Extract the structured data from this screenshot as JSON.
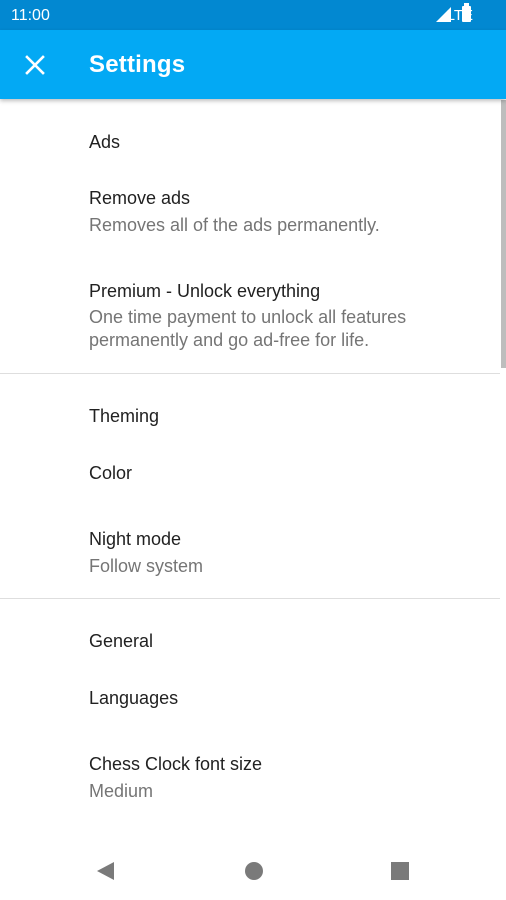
{
  "status_bar": {
    "time": "11:00",
    "network": "LTE",
    "signal_icon": "signal-icon",
    "battery_icon": "battery-icon"
  },
  "app_bar": {
    "title": "Settings",
    "close_icon": "close-icon",
    "color": "#03a9f4"
  },
  "sections": {
    "ads": {
      "header": "Ads",
      "remove_ads": {
        "title": "Remove ads",
        "summary": "Removes all of the ads permanently."
      },
      "premium": {
        "title": "Premium - Unlock everything",
        "summary": "One time payment to unlock all features permanently and go ad-free for life."
      }
    },
    "theming": {
      "header": "Theming",
      "color": {
        "title": "Color"
      },
      "night_mode": {
        "title": "Night mode",
        "summary": "Follow system"
      }
    },
    "general": {
      "header": "General",
      "languages": {
        "title": "Languages"
      },
      "font_size": {
        "title": "Chess Clock font size",
        "summary": "Medium"
      }
    }
  },
  "nav_bar": {
    "back_icon": "back-icon",
    "home_icon": "home-icon",
    "recents_icon": "recents-icon"
  }
}
